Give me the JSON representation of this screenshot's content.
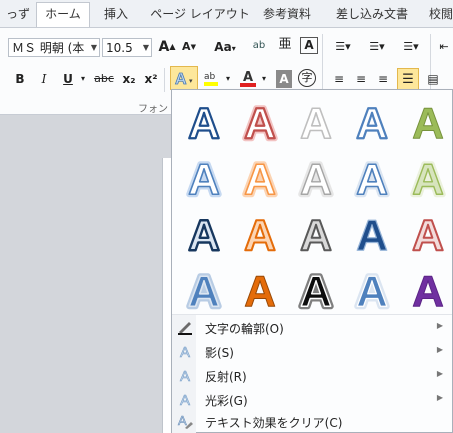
{
  "tabs": [
    {
      "label": "っず",
      "active": false
    },
    {
      "label": "ホーム",
      "active": true
    },
    {
      "label": "挿入",
      "active": false
    },
    {
      "label": "ページ レイアウト",
      "active": false
    },
    {
      "label": "参考資料",
      "active": false
    },
    {
      "label": "差し込み文書",
      "active": false
    },
    {
      "label": "校閲",
      "active": false
    }
  ],
  "font": {
    "name": "ＭＳ 明朝 (本",
    "size": "10.5",
    "grow_icon": "font-grow-icon",
    "shrink_icon": "font-shrink-icon",
    "case_label": "Aa",
    "group_label": "フォント"
  },
  "format_buttons": {
    "bold": "B",
    "italic": "I",
    "underline": "U",
    "strike": "abc",
    "subscript": "x₂",
    "superscript": "x²"
  },
  "effects_gallery": {
    "accent": "#f5c542",
    "rows": 4,
    "columns": 5
  },
  "menu_items": [
    {
      "label": "文字の輪郭(O)",
      "icon": "pen-outline-icon",
      "has_submenu": true
    },
    {
      "label": "影(S)",
      "icon": "shadow-a-icon",
      "has_submenu": true
    },
    {
      "label": "反射(R)",
      "icon": "reflection-a-icon",
      "has_submenu": true
    },
    {
      "label": "光彩(G)",
      "icon": "glow-a-icon",
      "has_submenu": true
    },
    {
      "label": "テキスト効果をクリア(C)",
      "icon": "clear-effects-icon",
      "has_submenu": false
    }
  ]
}
